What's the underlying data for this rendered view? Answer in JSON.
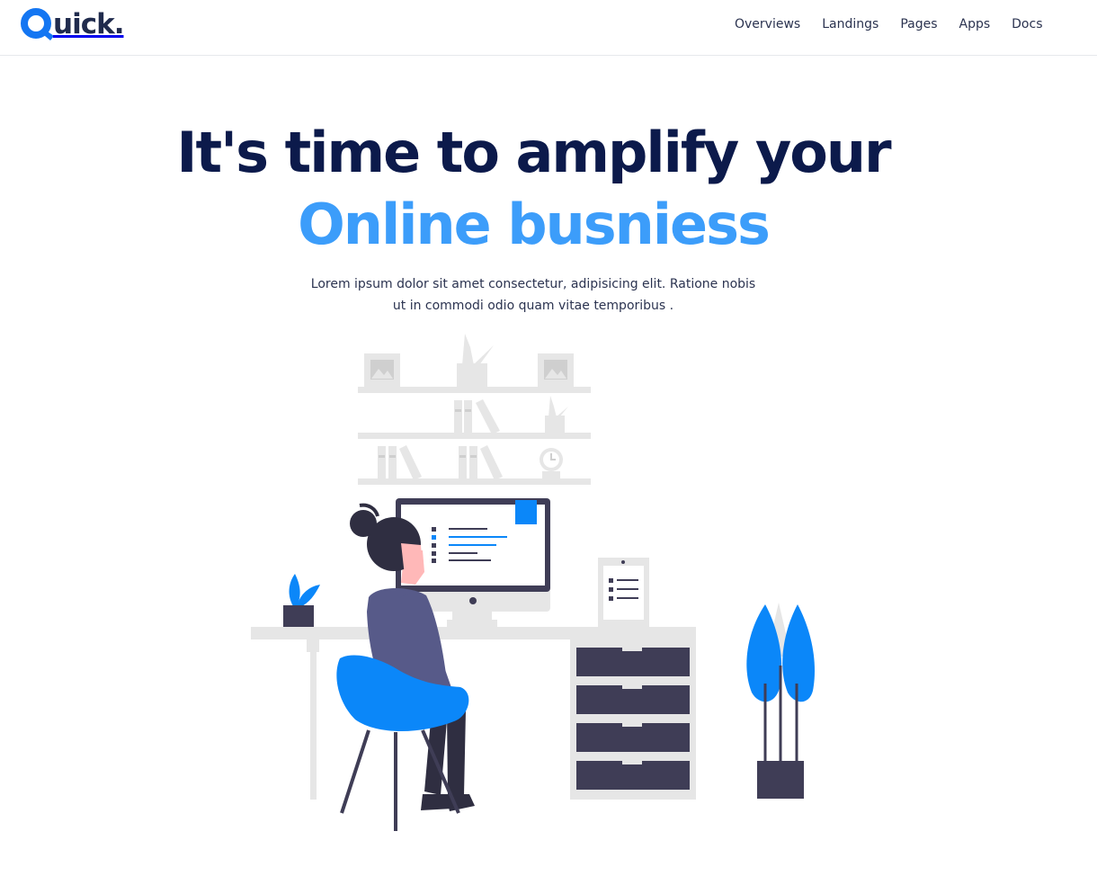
{
  "brand": {
    "name": "uick.",
    "logo_letter": "Q",
    "accent": "#1476f2",
    "text_color": "#202b4d"
  },
  "nav": {
    "items": [
      {
        "label": "Overviews"
      },
      {
        "label": "Landings"
      },
      {
        "label": "Pages"
      },
      {
        "label": "Apps"
      },
      {
        "label": "Docs"
      }
    ]
  },
  "hero": {
    "title_line1": "It's time to amplify your",
    "title_line2": "Online busniess",
    "subtitle": "Lorem ipsum dolor sit amet consectetur, adipisicing elit. Ratione nobis ut in commodi odio quam vitae temporibus .",
    "title_color": "#0c1a4b",
    "highlight_color": "#3c9dfa"
  },
  "illustration": {
    "name": "woman-at-desk-illustration",
    "colors": {
      "blue": "#0b87f9",
      "dark": "#3f3d56",
      "light": "#e6e6e6",
      "skin": "#ffb8b8"
    }
  }
}
